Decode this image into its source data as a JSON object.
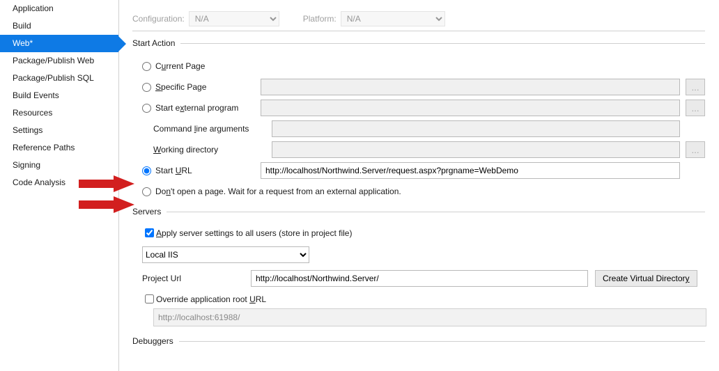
{
  "sidebar": {
    "items": [
      {
        "label": "Application",
        "selected": false
      },
      {
        "label": "Build",
        "selected": false
      },
      {
        "label": "Web*",
        "selected": true
      },
      {
        "label": "Package/Publish Web",
        "selected": false
      },
      {
        "label": "Package/Publish SQL",
        "selected": false
      },
      {
        "label": "Build Events",
        "selected": false
      },
      {
        "label": "Resources",
        "selected": false
      },
      {
        "label": "Settings",
        "selected": false
      },
      {
        "label": "Reference Paths",
        "selected": false
      },
      {
        "label": "Signing",
        "selected": false
      },
      {
        "label": "Code Analysis",
        "selected": false
      }
    ]
  },
  "topbar": {
    "configuration_label": "Configuration:",
    "configuration_value": "N/A",
    "platform_label": "Platform:",
    "platform_value": "N/A"
  },
  "start_action": {
    "section_title": "Start Action",
    "current_page": {
      "pre": "C",
      "u": "u",
      "post": "rrent Page"
    },
    "specific_page": {
      "u": "S",
      "post": "pecific Page"
    },
    "external_prog": {
      "pre": "Start e",
      "u": "x",
      "post": "ternal program"
    },
    "cmd_args": {
      "pre": "Command ",
      "u": "l",
      "post": "ine arguments"
    },
    "work_dir": {
      "u": "W",
      "post": "orking directory"
    },
    "start_url": {
      "pre": "Start ",
      "u": "U",
      "post": "RL"
    },
    "start_url_value": "http://localhost/Northwind.Server/request.aspx?prgname=WebDemo",
    "dont_open": {
      "pre": "Do",
      "u": "n",
      "post": "'t open a page.  Wait for a request from an external application."
    },
    "ellipsis": "...",
    "selected": "start_url"
  },
  "servers": {
    "section_title": "Servers",
    "apply_all": {
      "u": "A",
      "post": "pply server settings to all users (store in project file)",
      "checked": true
    },
    "server_select_value": "Local IIS",
    "project_url_label": "Project Url",
    "project_url_value": "http://localhost/Northwind.Server/",
    "create_vd": {
      "pre": "Create Virtual Director",
      "u": "y"
    },
    "override": {
      "pre": "Override application root ",
      "u": "U",
      "post": "RL",
      "checked": false
    },
    "override_value": "http://localhost:61988/"
  },
  "debuggers": {
    "section_title": "Debuggers"
  }
}
